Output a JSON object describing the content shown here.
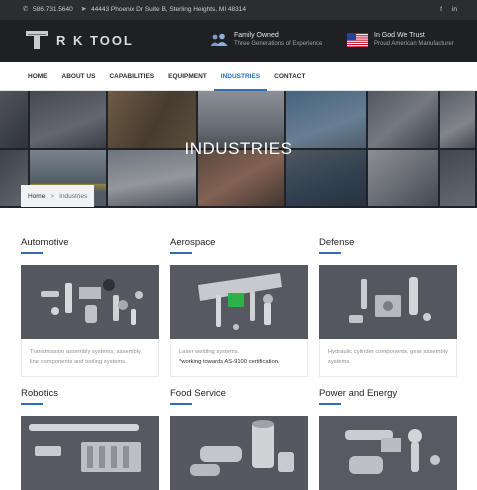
{
  "topbar": {
    "phone": "586.731.5640",
    "address": "44443 Phoenix Dr Suite B, Sterling Heights, MI 48314",
    "social": [
      "f",
      "in"
    ]
  },
  "header": {
    "logo_text": "R K TOOL",
    "badge1": {
      "title": "Family Owned",
      "subtitle": "Three Generations of Experience",
      "icon": "people-icon"
    },
    "badge2": {
      "title": "In God We Trust",
      "subtitle": "Proud American Manufacturer",
      "icon": "us-flag-icon"
    }
  },
  "nav": {
    "items": [
      "HOME",
      "ABOUT US",
      "CAPABILITIES",
      "EQUIPMENT",
      "INDUSTRIES",
      "CONTACT"
    ],
    "active": "INDUSTRIES"
  },
  "hero": {
    "title": "INDUSTRIES",
    "breadcrumb": {
      "home": "Home",
      "separator": ">",
      "current": "Industries"
    }
  },
  "industries": [
    {
      "title": "Automotive",
      "description": "Transmission assembly systems, assembly line components and tooling systems.",
      "note": ""
    },
    {
      "title": "Aerospace",
      "description": "Laser welding systems.",
      "note": "*working towards AS-9100 certification."
    },
    {
      "title": "Defense",
      "description": "Hydraulic cylinder components, gear assembly systems.",
      "note": ""
    },
    {
      "title": "Robotics",
      "description": "",
      "note": ""
    },
    {
      "title": "Food Service",
      "description": "",
      "note": ""
    },
    {
      "title": "Power and Energy",
      "description": "",
      "note": ""
    }
  ],
  "colors": {
    "accent": "#2f6fb5",
    "topbar_bg": "#2b2d31",
    "header_bg": "#1e2024",
    "text_dark": "#1c1f24"
  }
}
